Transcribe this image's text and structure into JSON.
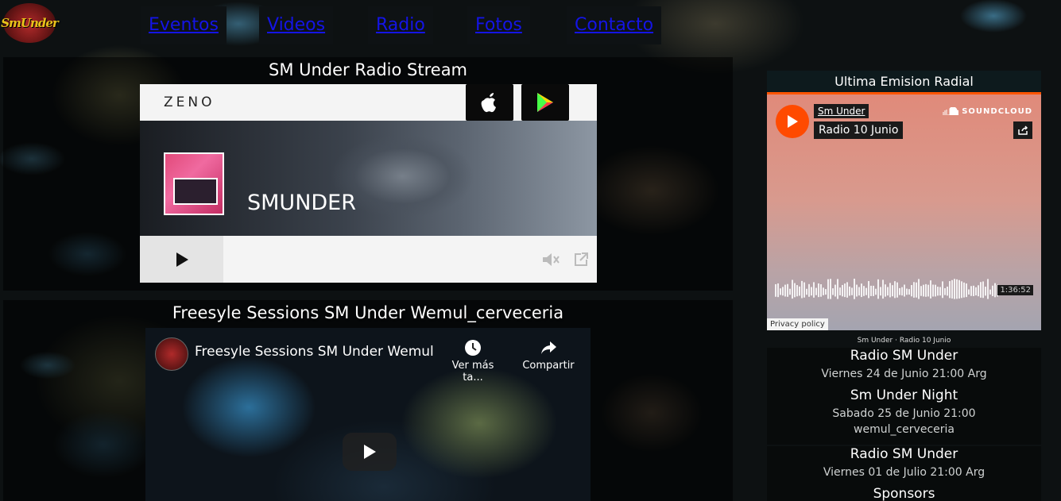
{
  "brand": {
    "logo_text": "SmUnder"
  },
  "nav": {
    "items": [
      "Eventos",
      "Videos",
      "Radio",
      "Fotos",
      "Contacto"
    ]
  },
  "radio_panel": {
    "title": "SM Under Radio Stream",
    "player": {
      "brand": "ZENO",
      "station_name": "SMUNDER"
    }
  },
  "video_panel": {
    "title": "Freesyle Sessions SM Under Wemul_cerveceria",
    "video_title": "Freesyle Sessions SM Under Wemul...",
    "watch_later": "Ver más ta...",
    "share": "Compartir"
  },
  "right": {
    "title": "Ultima Emision Radial",
    "soundcloud": {
      "user": "Sm Under",
      "track": "Radio 10 Junio",
      "brand": "SOUNDCLOUD",
      "duration": "1:36:52",
      "privacy": "Privacy policy",
      "credit_user": "Sm Under",
      "credit_sep": "·",
      "credit_track": "Radio 10 Junio"
    },
    "events": [
      {
        "title": "Radio SM Under",
        "lines": [
          "Viernes 24 de Junio 21:00 Arg"
        ]
      },
      {
        "title": "Sm Under Night",
        "lines": [
          "Sabado 25 de Junio 21:00",
          "wemul_cerveceria"
        ]
      },
      {
        "title": "Radio SM Under",
        "lines": [
          "Viernes 01 de Julio 21:00 Arg"
        ]
      }
    ],
    "sponsors": "Sponsors"
  },
  "colors": {
    "nav_link": "#1414e6",
    "soundcloud_orange": "#ff5500"
  }
}
